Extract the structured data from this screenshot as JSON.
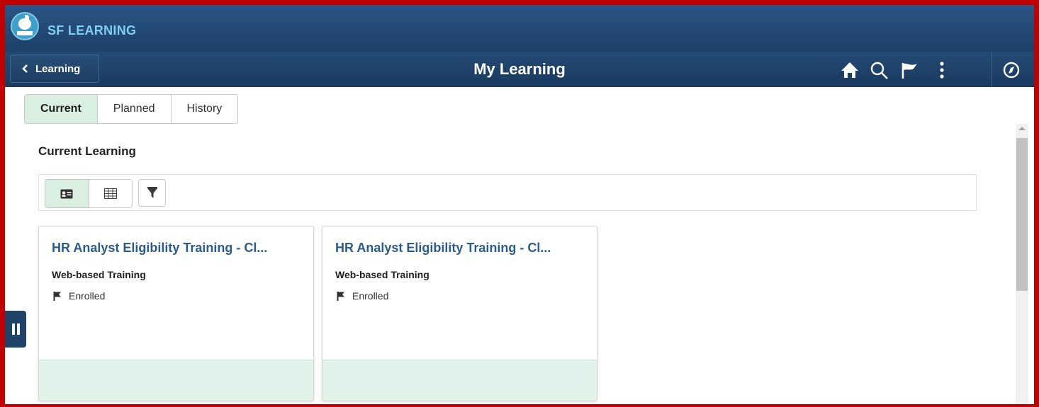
{
  "brand": {
    "name": "SF LEARNING",
    "logo_icon": "apple-book-logo-icon"
  },
  "header": {
    "back_label": "Learning",
    "title": "My Learning",
    "actions": [
      "home-icon",
      "search-icon",
      "flag-icon",
      "more-icon",
      "navigator-icon"
    ]
  },
  "tabs": [
    {
      "label": "Current",
      "active": true
    },
    {
      "label": "Planned",
      "active": false
    },
    {
      "label": "History",
      "active": false
    }
  ],
  "section": {
    "title": "Current Learning"
  },
  "toolbar": {
    "views": [
      "card-view-icon",
      "grid-view-icon"
    ],
    "active_view": "card-view-icon",
    "filter_icon": "filter-icon"
  },
  "cards": [
    {
      "title": "HR Analyst Eligibility Training - Cl...",
      "type": "Web-based Training",
      "status": "Enrolled"
    },
    {
      "title": "HR Analyst Eligibility Training - Cl...",
      "type": "Web-based Training",
      "status": "Enrolled"
    }
  ],
  "colors": {
    "frame_border": "#c00000",
    "header_bg": "#1c3f66",
    "active_tab_bg": "#d8efe2",
    "card_title": "#2b5c8a",
    "card_footer_bg": "#e0f2e9",
    "brand_text": "#7fd0ef"
  }
}
